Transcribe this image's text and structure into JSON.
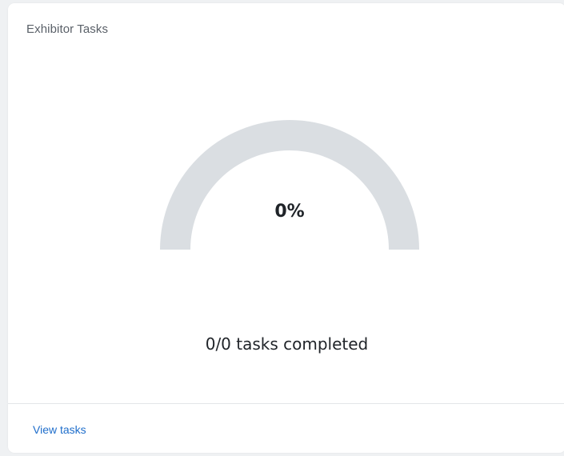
{
  "widget": {
    "title": "Exhibitor Tasks",
    "gauge": {
      "percent_label": "0%",
      "progress": 0,
      "track_color": "#dadee2",
      "fill_color": "#1f6ecb"
    },
    "summary": "0/0 tasks completed",
    "link_label": "View tasks"
  }
}
